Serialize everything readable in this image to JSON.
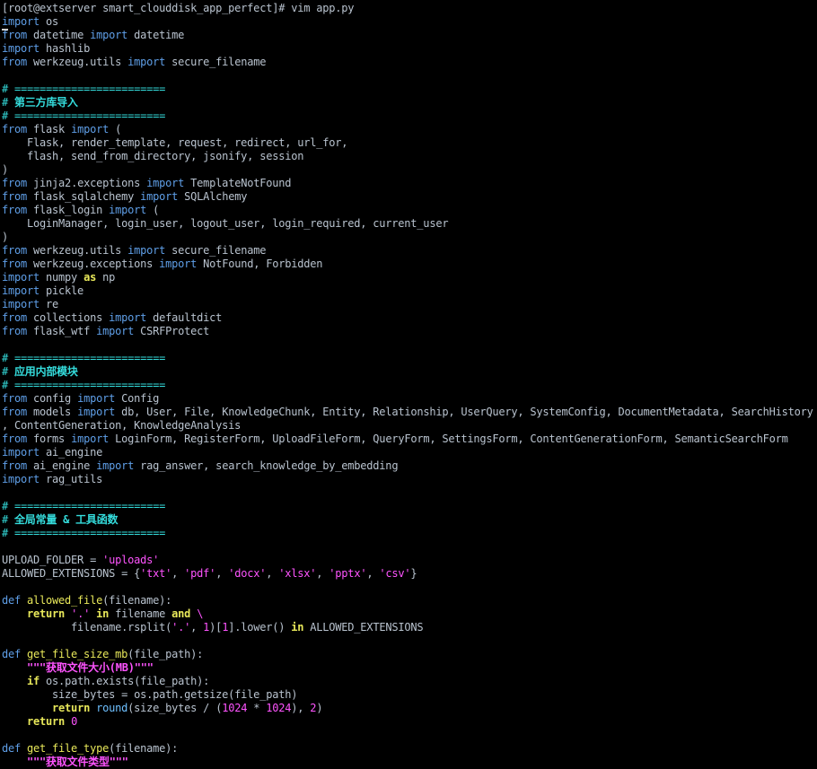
{
  "terminal": {
    "prompt": "[root@extserver smart_clouddisk_app_perfect]# vim app.py",
    "colors": {
      "background": "#000000",
      "text": "#b9c3cf",
      "keyword": "#5f9fe8",
      "string": "#ff54ff",
      "comment": "#34dcdc",
      "function_name": "#e8e85a",
      "number": "#ff54ff",
      "builtin": "#6ec0ff"
    },
    "lines": [
      [
        [
          "kw",
          "import"
        ],
        [
          "tx",
          " os"
        ]
      ],
      [
        [
          "kw",
          "from"
        ],
        [
          "tx",
          " datetime "
        ],
        [
          "kw",
          "import"
        ],
        [
          "tx",
          " datetime"
        ]
      ],
      [
        [
          "kw",
          "import"
        ],
        [
          "tx",
          " hashlib"
        ]
      ],
      [
        [
          "kw",
          "from"
        ],
        [
          "tx",
          " werkzeug.utils "
        ],
        [
          "kw",
          "import"
        ],
        [
          "tx",
          " secure_filename"
        ]
      ],
      [],
      [
        [
          "cm",
          "# ========================"
        ]
      ],
      [
        [
          "cm",
          "# "
        ],
        [
          "hd",
          "第三方库导入"
        ]
      ],
      [
        [
          "cm",
          "# ========================"
        ]
      ],
      [
        [
          "kw",
          "from"
        ],
        [
          "tx",
          " flask "
        ],
        [
          "kw",
          "import"
        ],
        [
          "tx",
          " ("
        ]
      ],
      [
        [
          "tx",
          "    Flask, render_template, request, redirect, url_for,"
        ]
      ],
      [
        [
          "tx",
          "    flash, send_from_directory, jsonify, session"
        ]
      ],
      [
        [
          "tx",
          ")"
        ]
      ],
      [
        [
          "kw",
          "from"
        ],
        [
          "tx",
          " jinja2.exceptions "
        ],
        [
          "kw",
          "import"
        ],
        [
          "tx",
          " TemplateNotFound"
        ]
      ],
      [
        [
          "kw",
          "from"
        ],
        [
          "tx",
          " flask_sqlalchemy "
        ],
        [
          "kw",
          "import"
        ],
        [
          "tx",
          " SQLAlchemy"
        ]
      ],
      [
        [
          "kw",
          "from"
        ],
        [
          "tx",
          " flask_login "
        ],
        [
          "kw",
          "import"
        ],
        [
          "tx",
          " ("
        ]
      ],
      [
        [
          "tx",
          "    LoginManager, login_user, logout_user, login_required, current_user"
        ]
      ],
      [
        [
          "tx",
          ")"
        ]
      ],
      [
        [
          "kw",
          "from"
        ],
        [
          "tx",
          " werkzeug.utils "
        ],
        [
          "kw",
          "import"
        ],
        [
          "tx",
          " secure_filename"
        ]
      ],
      [
        [
          "kw",
          "from"
        ],
        [
          "tx",
          " werkzeug.exceptions "
        ],
        [
          "kw",
          "import"
        ],
        [
          "tx",
          " NotFound, Forbidden"
        ]
      ],
      [
        [
          "kw",
          "import"
        ],
        [
          "tx",
          " numpy "
        ],
        [
          "yk",
          "as"
        ],
        [
          "tx",
          " np"
        ]
      ],
      [
        [
          "kw",
          "import"
        ],
        [
          "tx",
          " pickle"
        ]
      ],
      [
        [
          "kw",
          "import"
        ],
        [
          "tx",
          " re"
        ]
      ],
      [
        [
          "kw",
          "from"
        ],
        [
          "tx",
          " collections "
        ],
        [
          "kw",
          "import"
        ],
        [
          "tx",
          " defaultdict"
        ]
      ],
      [
        [
          "kw",
          "from"
        ],
        [
          "tx",
          " flask_wtf "
        ],
        [
          "kw",
          "import"
        ],
        [
          "tx",
          " CSRFProtect"
        ]
      ],
      [],
      [
        [
          "cm",
          "# ========================"
        ]
      ],
      [
        [
          "cm",
          "# "
        ],
        [
          "hd",
          "应用内部模块"
        ]
      ],
      [
        [
          "cm",
          "# ========================"
        ]
      ],
      [
        [
          "kw",
          "from"
        ],
        [
          "tx",
          " config "
        ],
        [
          "kw",
          "import"
        ],
        [
          "tx",
          " Config"
        ]
      ],
      [
        [
          "kw",
          "from"
        ],
        [
          "tx",
          " models "
        ],
        [
          "kw",
          "import"
        ],
        [
          "tx",
          " db, User, File, KnowledgeChunk, Entity, Relationship, UserQuery, SystemConfig, DocumentMetadata, SearchHistory"
        ]
      ],
      [
        [
          "tx",
          ", ContentGeneration, KnowledgeAnalysis"
        ]
      ],
      [
        [
          "kw",
          "from"
        ],
        [
          "tx",
          " forms "
        ],
        [
          "kw",
          "import"
        ],
        [
          "tx",
          " LoginForm, RegisterForm, UploadFileForm, QueryForm, SettingsForm, ContentGenerationForm, SemanticSearchForm"
        ]
      ],
      [
        [
          "kw",
          "import"
        ],
        [
          "tx",
          " ai_engine"
        ]
      ],
      [
        [
          "kw",
          "from"
        ],
        [
          "tx",
          " ai_engine "
        ],
        [
          "kw",
          "import"
        ],
        [
          "tx",
          " rag_answer, search_knowledge_by_embedding"
        ]
      ],
      [
        [
          "kw",
          "import"
        ],
        [
          "tx",
          " rag_utils"
        ]
      ],
      [],
      [
        [
          "cm",
          "# ========================"
        ]
      ],
      [
        [
          "cm",
          "# "
        ],
        [
          "hd",
          "全局常量 & 工具函数"
        ]
      ],
      [
        [
          "cm",
          "# ========================"
        ]
      ],
      [],
      [
        [
          "tx",
          "UPLOAD_FOLDER = "
        ],
        [
          "st",
          "'uploads'"
        ]
      ],
      [
        [
          "tx",
          "ALLOWED_EXTENSIONS = {"
        ],
        [
          "st",
          "'txt'"
        ],
        [
          "tx",
          ", "
        ],
        [
          "st",
          "'pdf'"
        ],
        [
          "tx",
          ", "
        ],
        [
          "st",
          "'docx'"
        ],
        [
          "tx",
          ", "
        ],
        [
          "st",
          "'xlsx'"
        ],
        [
          "tx",
          ", "
        ],
        [
          "st",
          "'pptx'"
        ],
        [
          "tx",
          ", "
        ],
        [
          "st",
          "'csv'"
        ],
        [
          "tx",
          "}"
        ]
      ],
      [],
      [
        [
          "kw",
          "def"
        ],
        [
          "fn",
          " allowed_file"
        ],
        [
          "tx",
          "(filename):"
        ]
      ],
      [
        [
          "tx",
          "    "
        ],
        [
          "yk",
          "return"
        ],
        [
          "tx",
          " "
        ],
        [
          "st",
          "'.'"
        ],
        [
          "tx",
          " "
        ],
        [
          "yk",
          "in"
        ],
        [
          "tx",
          " filename "
        ],
        [
          "yk",
          "and"
        ],
        [
          "tx",
          " "
        ],
        [
          "st",
          "\\"
        ]
      ],
      [
        [
          "tx",
          "           filename.rsplit("
        ],
        [
          "st",
          "'.'"
        ],
        [
          "tx",
          ", "
        ],
        [
          "nm",
          "1"
        ],
        [
          "tx",
          ")["
        ],
        [
          "nm",
          "1"
        ],
        [
          "tx",
          "].lower() "
        ],
        [
          "yk",
          "in"
        ],
        [
          "tx",
          " ALLOWED_EXTENSIONS"
        ]
      ],
      [],
      [
        [
          "kw",
          "def"
        ],
        [
          "fn",
          " get_file_size_mb"
        ],
        [
          "tx",
          "(file_path):"
        ]
      ],
      [
        [
          "tx",
          "    "
        ],
        [
          "ds",
          "\"\"\"获取文件大小(MB)\"\"\""
        ]
      ],
      [
        [
          "tx",
          "    "
        ],
        [
          "yk",
          "if"
        ],
        [
          "tx",
          " os.path.exists(file_path):"
        ]
      ],
      [
        [
          "tx",
          "        size_bytes = os.path.getsize(file_path)"
        ]
      ],
      [
        [
          "tx",
          "        "
        ],
        [
          "yk",
          "return"
        ],
        [
          "tx",
          " "
        ],
        [
          "bt",
          "round"
        ],
        [
          "tx",
          "(size_bytes / ("
        ],
        [
          "nm",
          "1024"
        ],
        [
          "tx",
          " * "
        ],
        [
          "nm",
          "1024"
        ],
        [
          "tx",
          "), "
        ],
        [
          "nm",
          "2"
        ],
        [
          "tx",
          ")"
        ]
      ],
      [
        [
          "tx",
          "    "
        ],
        [
          "yk",
          "return"
        ],
        [
          "tx",
          " "
        ],
        [
          "nm",
          "0"
        ]
      ],
      [],
      [
        [
          "kw",
          "def"
        ],
        [
          "fn",
          " get_file_type"
        ],
        [
          "tx",
          "(filename):"
        ]
      ],
      [
        [
          "tx",
          "    "
        ],
        [
          "ds",
          "\"\"\"获取文件类型\"\"\""
        ]
      ]
    ]
  }
}
